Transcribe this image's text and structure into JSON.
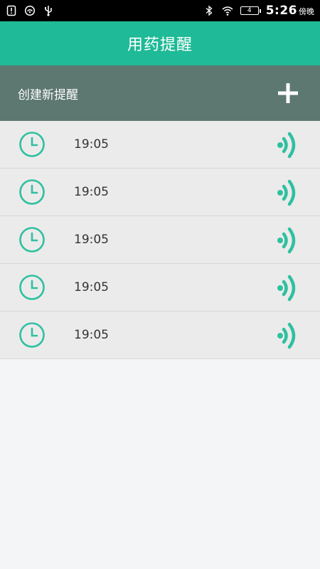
{
  "status_bar": {
    "time": "5:26",
    "ampm": "傍晚",
    "battery": "4",
    "icons_left": [
      "notification-icon",
      "message-icon",
      "usb-icon"
    ],
    "icons_right": [
      "bluetooth-icon",
      "wifi-icon",
      "battery-icon"
    ]
  },
  "header": {
    "title": "用药提醒"
  },
  "create": {
    "label": "创建新提醒",
    "button_icon": "plus-icon"
  },
  "reminders": [
    {
      "time": "19:05"
    },
    {
      "time": "19:05"
    },
    {
      "time": "19:05"
    },
    {
      "time": "19:05"
    },
    {
      "time": "19:05"
    }
  ],
  "colors": {
    "accent": "#1fba97",
    "create_bar": "#5d7771",
    "list_bg": "#ebebeb",
    "page_bg": "#f3f5f7"
  }
}
